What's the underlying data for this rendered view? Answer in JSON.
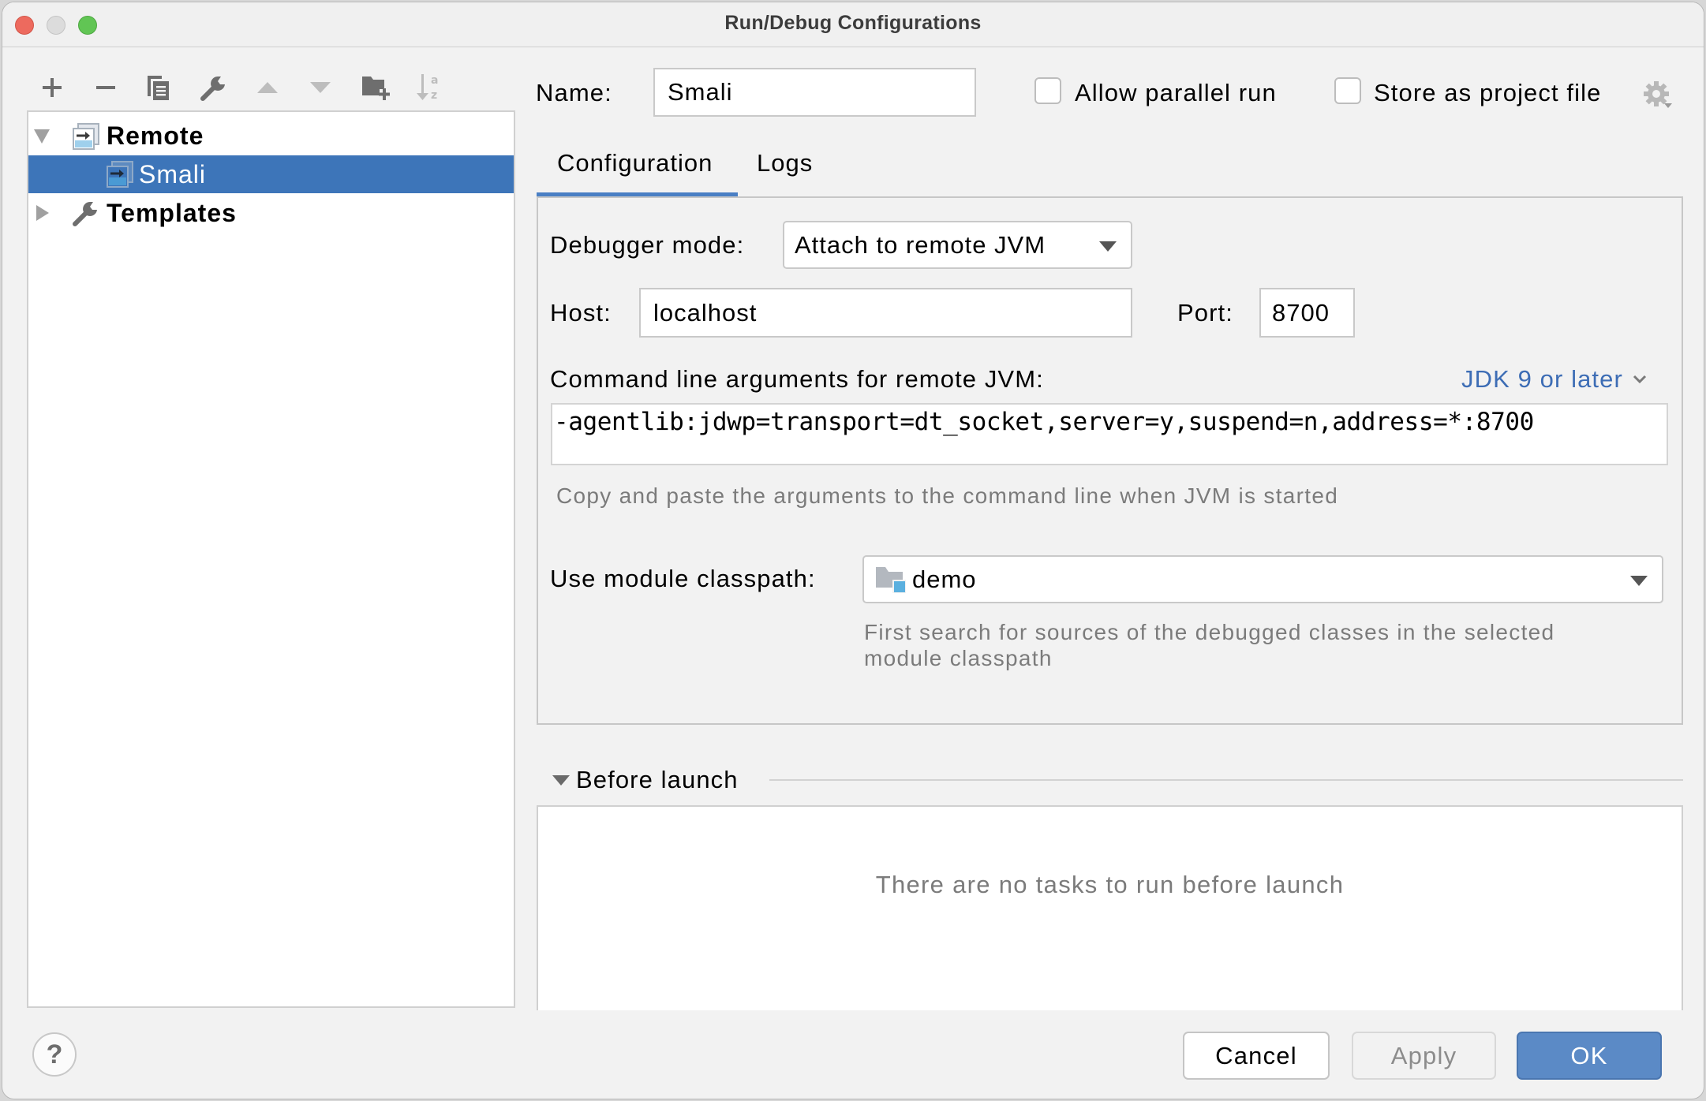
{
  "window": {
    "title": "Run/Debug Configurations",
    "controls": [
      "close",
      "minimize",
      "maximize"
    ]
  },
  "toolbar": {
    "items": [
      {
        "name": "add",
        "icon": "plus-icon",
        "enabled": true
      },
      {
        "name": "remove",
        "icon": "minus-icon",
        "enabled": true
      },
      {
        "name": "copy",
        "icon": "copy-icon",
        "enabled": true
      },
      {
        "name": "edit-templates",
        "icon": "wrench-icon",
        "enabled": true
      },
      {
        "name": "move-up",
        "icon": "arrow-up-icon",
        "enabled": false
      },
      {
        "name": "move-down",
        "icon": "arrow-down-icon",
        "enabled": false
      },
      {
        "name": "new-folder",
        "icon": "folder-add-icon",
        "enabled": true
      },
      {
        "name": "sort",
        "icon": "sort-alpha-icon",
        "enabled": false
      }
    ]
  },
  "tree": {
    "items": [
      {
        "label": "Remote",
        "level": 0,
        "expanded": true,
        "bold": true,
        "icon": "remote-config-icon"
      },
      {
        "label": "Smali",
        "level": 1,
        "selected": true,
        "icon": "remote-config-icon"
      },
      {
        "label": "Templates",
        "level": 0,
        "expanded": false,
        "bold": true,
        "icon": "wrench-icon"
      }
    ]
  },
  "header": {
    "name_label": "Name:",
    "name_value": "Smali",
    "allow_parallel_label": "Allow parallel run",
    "allow_parallel_checked": false,
    "store_project_label": "Store as project file",
    "store_project_checked": false
  },
  "tabs": [
    {
      "label": "Configuration",
      "active": true
    },
    {
      "label": "Logs",
      "active": false
    }
  ],
  "config": {
    "debugger_mode_label": "Debugger mode:",
    "debugger_mode_value": "Attach to remote JVM",
    "host_label": "Host:",
    "host_value": "localhost",
    "port_label": "Port:",
    "port_value": "8700",
    "cmd_label": "Command line arguments for remote JVM:",
    "jdk_link": "JDK 9 or later",
    "cmd_value": "-agentlib:jdwp=transport=dt_socket,server=y,suspend=n,address=*:8700",
    "cmd_hint": "Copy and paste the arguments to the command line when JVM is started",
    "module_label": "Use module classpath:",
    "module_value": "demo",
    "module_hint_line1": "First search for sources of the debugged classes in the selected",
    "module_hint_line2": "module classpath"
  },
  "before_launch": {
    "title": "Before launch",
    "expanded": true,
    "empty_text": "There are no tasks to run before launch"
  },
  "footer": {
    "help_label": "?",
    "cancel_label": "Cancel",
    "apply_label": "Apply",
    "apply_enabled": false,
    "ok_label": "OK"
  },
  "colors": {
    "accent": "#3d75b9",
    "ok_button": "#5b8ac6",
    "link": "#3d6db5",
    "hint_text": "#7b7b7b",
    "background": "#f2f2f2"
  }
}
